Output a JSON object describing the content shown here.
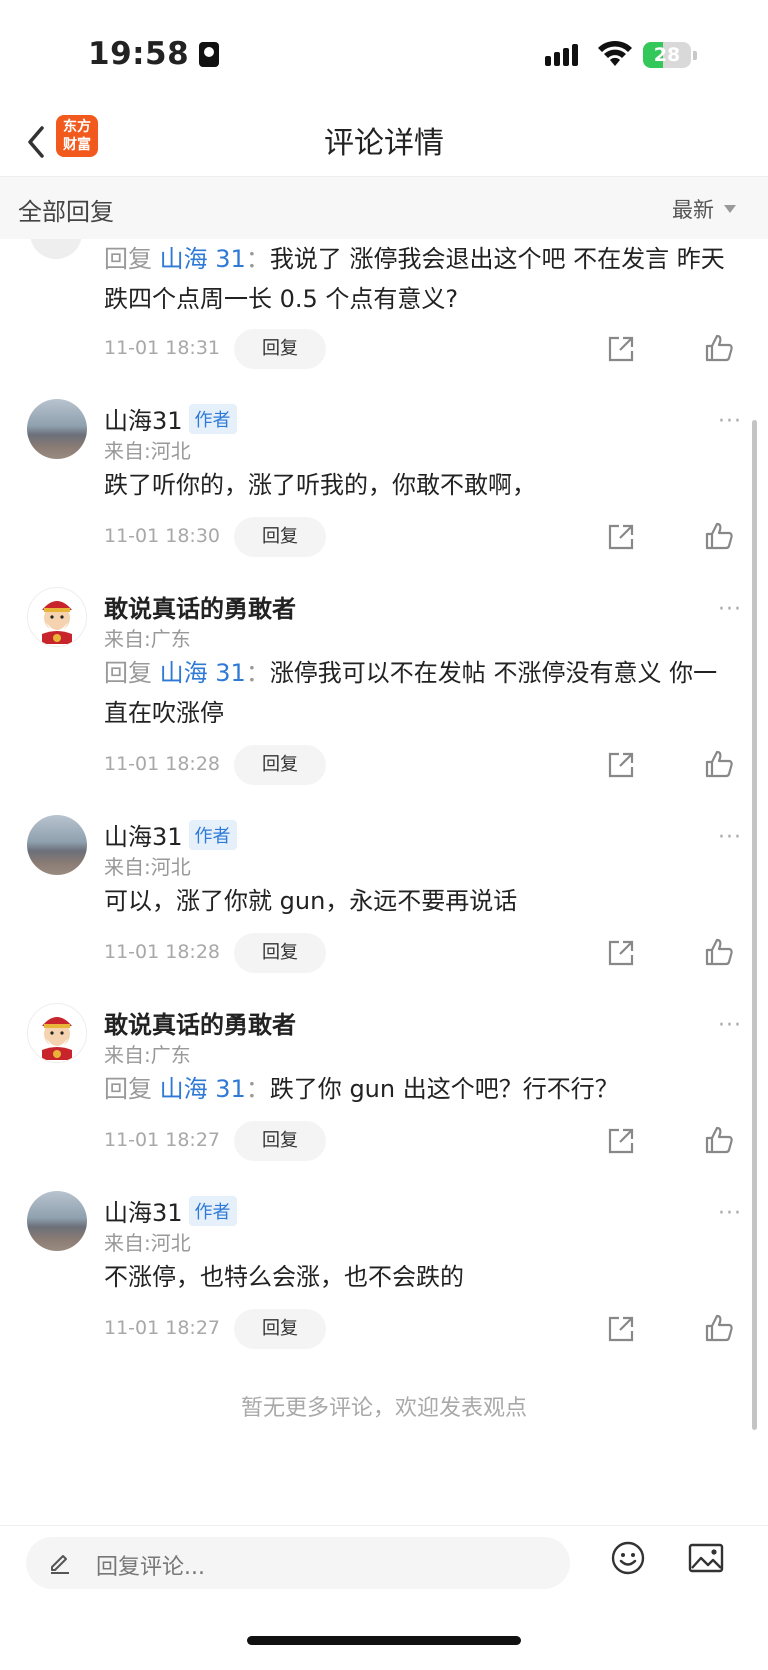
{
  "status_bar": {
    "time": "19:58",
    "battery": "28"
  },
  "header": {
    "title": "评论详情",
    "logo_line1": "东方",
    "logo_line2": "财富"
  },
  "filter": {
    "all_replies": "全部回复",
    "sort": "最新"
  },
  "comments": [
    {
      "reply_prefix": "回复 ",
      "reply_target": "山海 31",
      "reply_sep": "：",
      "text": "我说了 涨停我会退出这个吧 不在发言 昨天跌四个点周一长 0.5 个点有意义?",
      "date": "11-01 18:31",
      "reply_label": "回复"
    },
    {
      "user": "山海31",
      "badge": "作者",
      "location": "来自:河北",
      "text": "跌了听你的，涨了听我的，你敢不敢啊，",
      "date": "11-01 18:30",
      "reply_label": "回复",
      "more": "···"
    },
    {
      "user": "敢说真话的勇敢者",
      "location": "来自:广东",
      "reply_prefix": "回复 ",
      "reply_target": "山海 31",
      "reply_sep": "：",
      "text": "涨停我可以不在发帖  不涨停没有意义 你一直在吹涨停",
      "date": "11-01 18:28",
      "reply_label": "回复",
      "more": "···"
    },
    {
      "user": "山海31",
      "badge": "作者",
      "location": "来自:河北",
      "text": "可以，涨了你就 gun，永远不要再说话",
      "date": "11-01 18:28",
      "reply_label": "回复",
      "more": "···"
    },
    {
      "user": "敢说真话的勇敢者",
      "location": "来自:广东",
      "reply_prefix": "回复 ",
      "reply_target": "山海 31",
      "reply_sep": "：",
      "text": "跌了你 gun 出这个吧？行不行？",
      "date": "11-01 18:27",
      "reply_label": "回复",
      "more": "···"
    },
    {
      "user": "山海31",
      "badge": "作者",
      "location": "来自:河北",
      "text": "不涨停，也特么会涨，也不会跌的",
      "date": "11-01 18:27",
      "reply_label": "回复",
      "more": "···"
    }
  ],
  "end_note": "暂无更多评论，欢迎发表观点",
  "bottom_bar": {
    "placeholder": "回复评论..."
  },
  "colors": {
    "accent_blue": "#2f7ad6",
    "logo_orange": "#f25a1d",
    "battery_green": "#34c759"
  },
  "icons": [
    "back-arrow-icon",
    "pen-icon",
    "emoji-icon",
    "image-icon",
    "share-icon",
    "like-icon",
    "more-icon",
    "wifi-icon",
    "signal-icon"
  ]
}
